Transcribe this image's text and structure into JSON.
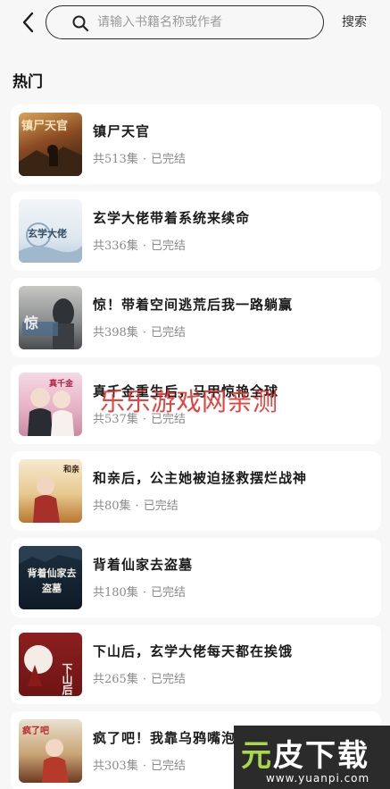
{
  "search": {
    "placeholder": "请输入书籍名称或作者",
    "button_label": "搜索"
  },
  "section_title": "热门",
  "books": [
    {
      "title": "镇尸天官",
      "episodes": "共513集",
      "status": "已完结",
      "cover_text": "镇尸天官"
    },
    {
      "title": "玄学大佬带着系统来续命",
      "episodes": "共336集",
      "status": "已完结",
      "cover_text": "玄学大佬"
    },
    {
      "title": "惊！带着空间逃荒后我一路躺赢",
      "episodes": "共398集",
      "status": "已完结",
      "cover_text": "惊"
    },
    {
      "title": "真千金重生后，马甲惊艳全球",
      "episodes": "共537集",
      "status": "已完结",
      "cover_text": "真千金"
    },
    {
      "title": "和亲后，公主她被迫拯救摆烂战神",
      "episodes": "共80集",
      "status": "已完结",
      "cover_text": "和亲"
    },
    {
      "title": "背着仙家去盗墓",
      "episodes": "共180集",
      "status": "已完结",
      "cover_text": "背着仙家去盗墓"
    },
    {
      "title": "下山后，玄学大佬每天都在挨饿",
      "episodes": "共265集",
      "status": "已完结",
      "cover_text": "下山后"
    },
    {
      "title": "疯了吧！我靠乌鸦嘴泡副紫种王苍",
      "episodes": "共303集",
      "status": "已完结",
      "cover_text": "疯了吧"
    }
  ],
  "watermarks": {
    "red_text": "乐乐游戏网亲测",
    "logo_big_a": "元",
    "logo_big_b": "皮下载",
    "logo_small": "www.yuanpi.com"
  },
  "colors": {
    "background": "#f7f7f7",
    "card": "#ffffff",
    "meta": "#8a8a8a",
    "watermark_red": "#e2342f"
  }
}
